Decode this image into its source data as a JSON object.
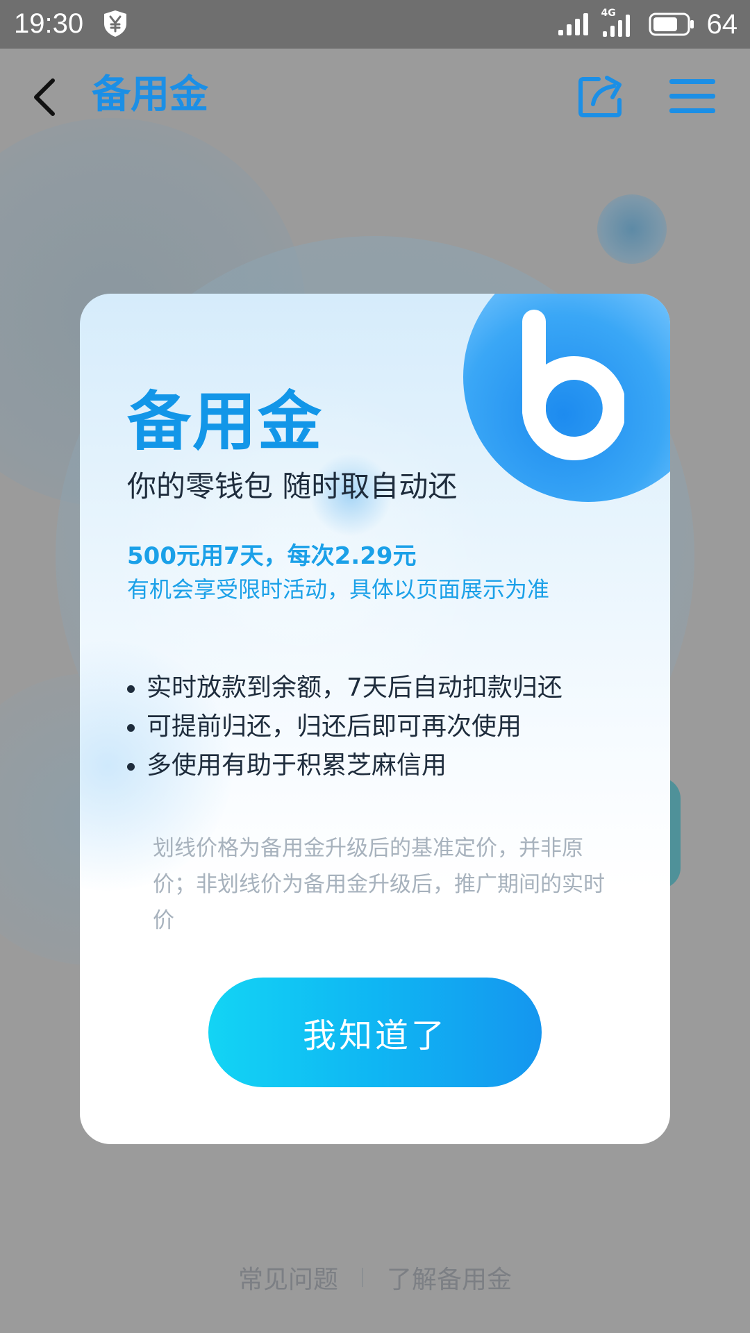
{
  "status_bar": {
    "time": "19:30",
    "battery_level": "64",
    "network_label": "4G"
  },
  "nav": {
    "title": "备用金"
  },
  "modal": {
    "title": "备用金",
    "subtitle": "你的零钱包 随时取自动还",
    "promo_line_1": "500元用7天，每次2.29元",
    "promo_line_2": "有机会享受限时活动，具体以页面展示为准",
    "bullets": [
      "实时放款到余额，7天后自动扣款归还",
      "可提前归还，归还后即可再次使用",
      "多使用有助于积累芝麻信用"
    ],
    "note": "划线价格为备用金升级后的基准定价，并非原价；非划线价为备用金升级后，推广期间的实时价",
    "button_label": "我知道了"
  },
  "footer": {
    "link_faq": "常见问题",
    "link_learn": "了解备用金"
  },
  "colors": {
    "accent_blue": "#1296e8",
    "button_start": "#13d4f4",
    "button_end": "#1596ef",
    "status_bar_bg": "#6f6f6f"
  },
  "icons": [
    "back-arrow-icon",
    "share-icon",
    "menu-icon",
    "yen-shield-icon",
    "signal-icon",
    "battery-icon",
    "b-logo-icon"
  ]
}
